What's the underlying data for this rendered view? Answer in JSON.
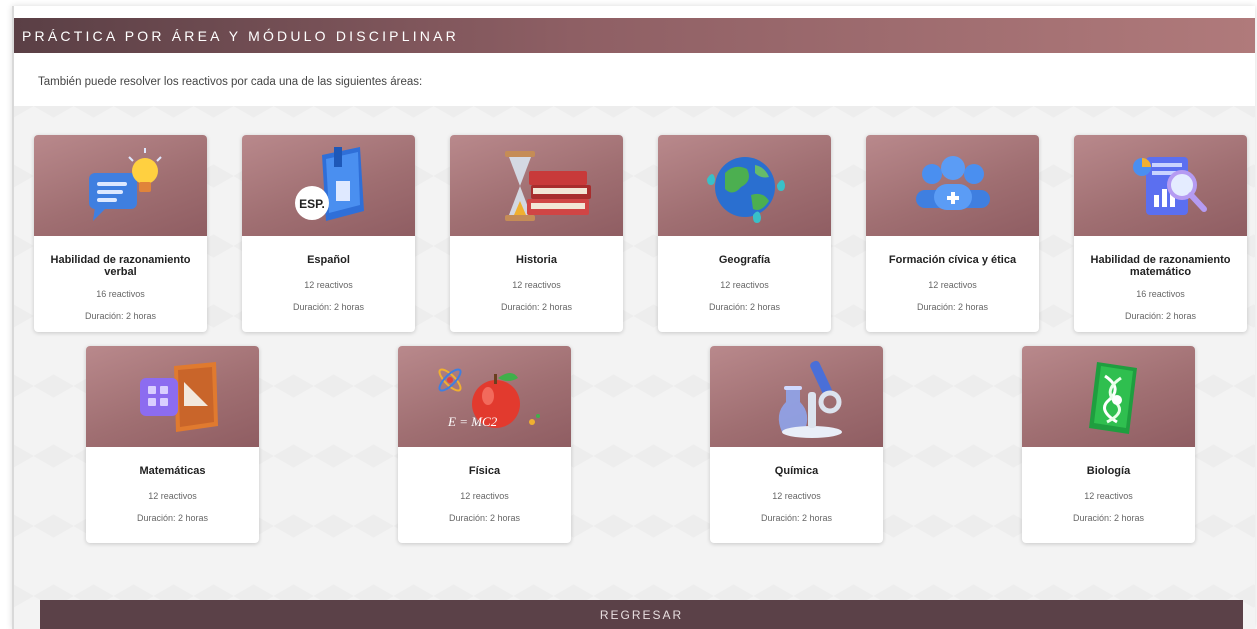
{
  "header": {
    "title": "PRÁCTICA POR ÁREA Y MÓDULO DISCIPLINAR"
  },
  "intro": "También puede resolver los reactivos por cada una de las siguientes áreas:",
  "cards": [
    {
      "title": "Habilidad de razonamiento verbal",
      "count": "16 reactivos",
      "duration": "Duración: 2 horas",
      "icon": "chat-bulb-icon"
    },
    {
      "title": "Español",
      "count": "12 reactivos",
      "duration": "Duración: 2 horas",
      "icon": "book-esp-icon",
      "badge": "ESP."
    },
    {
      "title": "Historia",
      "count": "12 reactivos",
      "duration": "Duración: 2 horas",
      "icon": "hourglass-books-icon"
    },
    {
      "title": "Geografía",
      "count": "12 reactivos",
      "duration": "Duración: 2 horas",
      "icon": "globe-icon"
    },
    {
      "title": "Formación cívica y ética",
      "count": "12 reactivos",
      "duration": "Duración: 2 horas",
      "icon": "people-icon"
    },
    {
      "title": "Habilidad de razonamiento matemático",
      "count": "16 reactivos",
      "duration": "Duración: 2 horas",
      "icon": "report-magnifier-icon"
    },
    {
      "title": "Matemáticas",
      "count": "12 reactivos",
      "duration": "Duración: 2 horas",
      "icon": "calculator-ruler-icon"
    },
    {
      "title": "Física",
      "count": "12 reactivos",
      "duration": "Duración: 2 horas",
      "icon": "apple-atom-icon",
      "formula": "E = MC2"
    },
    {
      "title": "Química",
      "count": "12 reactivos",
      "duration": "Duración: 2 horas",
      "icon": "microscope-icon"
    },
    {
      "title": "Biología",
      "count": "12 reactivos",
      "duration": "Duración: 2 horas",
      "icon": "dna-book-icon"
    }
  ],
  "back_button": "REGRESAR",
  "colors": {
    "header_start": "#5a3f45",
    "header_end": "#b07a7b",
    "card_image": "#a06f72",
    "back_bg": "#5b4148"
  }
}
